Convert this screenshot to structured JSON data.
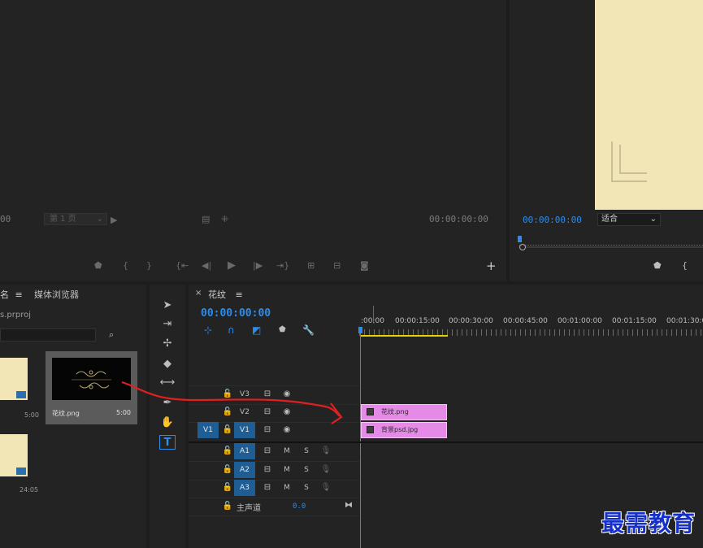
{
  "source": {
    "timecode_left": "00",
    "page_select": "第 1 页",
    "timecode_right": "00:00:00:00"
  },
  "program": {
    "timecode": "00:00:00:00",
    "fit_select": "适合"
  },
  "project": {
    "tab_name_fragment": "名",
    "tab_media_browser": "媒体浏览器",
    "project_file": "s.prproj",
    "items": [
      {
        "name": "",
        "duration": "5:00"
      },
      {
        "name": "花纹.png",
        "duration": "5:00"
      },
      {
        "name": "",
        "duration": "24:05"
      }
    ]
  },
  "timeline": {
    "sequence_name": "花纹",
    "timecode": "00:00:00:00",
    "ruler": [
      ":00:00",
      "00:00:15:00",
      "00:00:30:00",
      "00:00:45:00",
      "00:01:00:00",
      "00:01:15:00",
      "00:01:30:0"
    ],
    "tracks": {
      "v3": "V3",
      "v2": "V2",
      "v1": "V1",
      "src_v1": "V1",
      "a1": "A1",
      "a2": "A2",
      "a3": "A3",
      "m": "M",
      "s": "S",
      "master": "主声道",
      "master_value": "0.0"
    },
    "clips": {
      "v2": "花纹.png",
      "v1": "背景psd.jpg"
    }
  },
  "watermark": "最需教育",
  "colors": {
    "accent_blue": "#2d8ceb",
    "clip_pink": "#e58ae6",
    "cream": "#f2e6b6",
    "annotation_red": "#e02020"
  }
}
